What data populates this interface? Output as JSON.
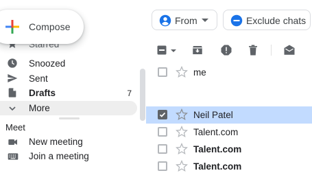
{
  "compose": {
    "label": "Compose",
    "icon": "plus-multicolor-icon"
  },
  "nav": {
    "partial_label": "Starred",
    "items": [
      {
        "label": "Snoozed",
        "icon": "clock-icon",
        "count": ""
      },
      {
        "label": "Sent",
        "icon": "send-icon",
        "count": ""
      },
      {
        "label": "Drafts",
        "icon": "file-icon",
        "count": "7"
      },
      {
        "label": "More",
        "icon": "chevron-down-icon",
        "count": ""
      }
    ]
  },
  "meet": {
    "title": "Meet",
    "items": [
      {
        "label": "New meeting",
        "icon": "videocam-icon"
      },
      {
        "label": "Join a meeting",
        "icon": "keyboard-icon"
      }
    ]
  },
  "filters": {
    "from_label": "From",
    "exclude_label": "Exclude chats"
  },
  "toolbar": {
    "icons": [
      "select-checkbox-icon",
      "archive-icon",
      "report-spam-icon",
      "delete-icon",
      "mark-read-icon"
    ]
  },
  "emails": [
    {
      "sender": "me",
      "selected": false,
      "unread": false
    },
    {
      "sender": "Neil Patel",
      "selected": true,
      "unread": false
    },
    {
      "sender": "Talent.com",
      "selected": false,
      "unread": false
    },
    {
      "sender": "Talent.com",
      "selected": false,
      "unread": true
    },
    {
      "sender": "Talent.com",
      "selected": false,
      "unread": true
    }
  ],
  "colors": {
    "selected_row": "#c2dbff",
    "chip_icon_blue": "#1a73e8",
    "icon_gray": "#5f6368"
  }
}
